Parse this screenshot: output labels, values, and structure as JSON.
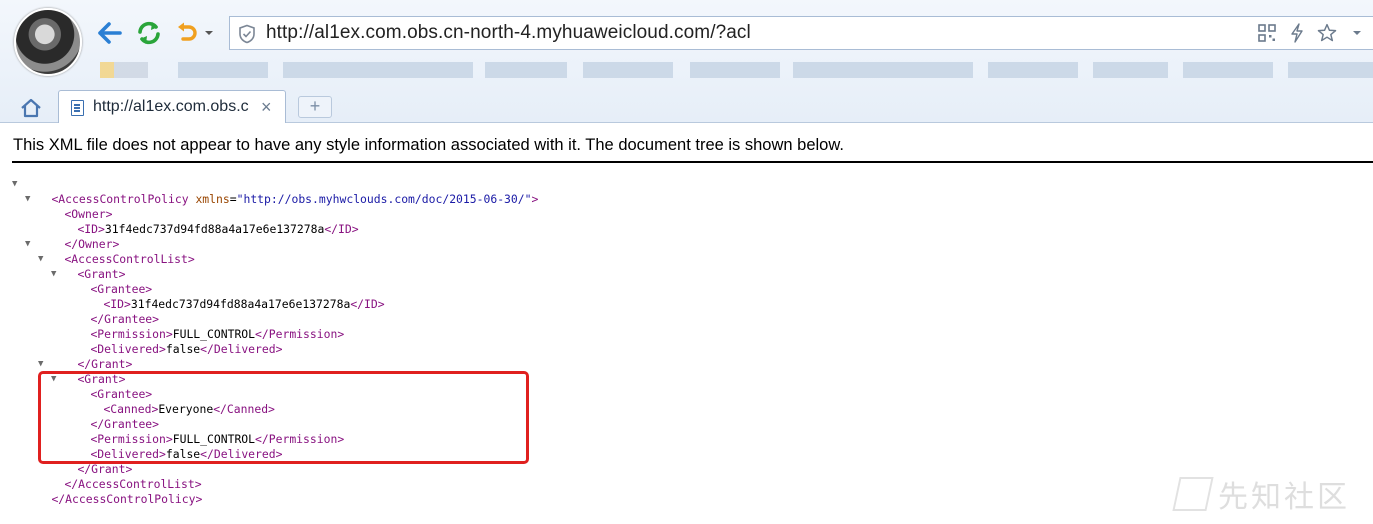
{
  "browser": {
    "url": "http://al1ex.com.obs.cn-north-4.myhuaweicloud.com/?acl",
    "tab_title": "http://al1ex.com.obs.c",
    "tab_close": "×",
    "new_tab": "+",
    "icons": [
      "back-arrow-icon",
      "refresh-icon",
      "undo-icon",
      "shield-icon",
      "qr-code-icon",
      "lightning-icon",
      "star-icon",
      "menu-caret-icon",
      "home-icon",
      "page-icon"
    ]
  },
  "notice": "This XML file does not appear to have any style information associated with it. The document tree is shown below.",
  "xml": {
    "root_open": "<AccessControlPolicy",
    "root_attr_name": "xmlns",
    "root_attr_eq": "=",
    "root_attr_value": "\"http://obs.myhwclouds.com/doc/2015-06-30/\"",
    "root_open_end": ">",
    "owner_open": "<Owner>",
    "id_open": "<ID>",
    "owner_id": "31f4edc737d94fd88a4a17e6e137278a",
    "id_close": "</ID>",
    "owner_close": "</Owner>",
    "acl_open": "<AccessControlList>",
    "grant_open": "<Grant>",
    "grantee_open": "<Grantee>",
    "grantee_id": "31f4edc737d94fd88a4a17e6e137278a",
    "grantee_close": "</Grantee>",
    "perm_open": "<Permission>",
    "permission": "FULL_CONTROL",
    "perm_close": "</Permission>",
    "delivered_open": "<Delivered>",
    "delivered": "false",
    "delivered_close": "</Delivered>",
    "grant_close": "</Grant>",
    "canned_open": "<Canned>",
    "canned": "Everyone",
    "canned_close": "</Canned>",
    "acl_close": "</AccessControlList>",
    "root_close": "</AccessControlPolicy>",
    "collapse_glyph": "▼"
  },
  "watermark": "先知社区",
  "colors": {
    "tag": "#881280",
    "attr_name": "#994500",
    "attr_value": "#1a1aa6",
    "highlight": "#e0201f"
  }
}
